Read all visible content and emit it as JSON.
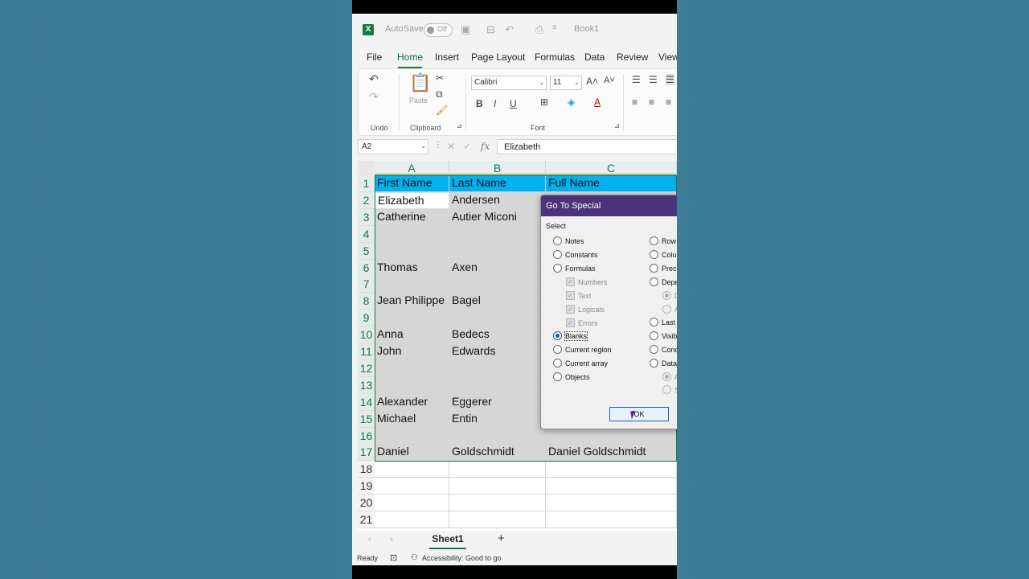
{
  "titlebar": {
    "logo": "X",
    "autosave_label": "AutoSave",
    "toggle_label": "Off",
    "book_title": "Book1"
  },
  "tabs": [
    "File",
    "Home",
    "Insert",
    "Page Layout",
    "Formulas",
    "Data",
    "Review",
    "View"
  ],
  "ribbon": {
    "undo_label": "Undo",
    "paste_label": "Paste",
    "clipboard_label": "Clipboard",
    "font_name": "Calibri",
    "font_size": "11",
    "font_label": "Font",
    "bold": "B",
    "italic": "I",
    "underline": "U"
  },
  "formula_bar": {
    "name_box": "A2",
    "fx": "fx",
    "value": "Elizabeth"
  },
  "grid": {
    "columns": [
      "A",
      "B",
      "C"
    ],
    "rows": [
      {
        "n": "1",
        "a": "First Name",
        "b": "Last Name",
        "c": "Full Name"
      },
      {
        "n": "2",
        "a": "Elizabeth",
        "b": "Andersen",
        "c": ""
      },
      {
        "n": "3",
        "a": "Catherine",
        "b": "Autier Miconi",
        "c": ""
      },
      {
        "n": "4",
        "a": "",
        "b": "",
        "c": ""
      },
      {
        "n": "5",
        "a": "",
        "b": "",
        "c": ""
      },
      {
        "n": "6",
        "a": "Thomas",
        "b": "Axen",
        "c": ""
      },
      {
        "n": "7",
        "a": "",
        "b": "",
        "c": ""
      },
      {
        "n": "8",
        "a": "Jean Philippe",
        "b": "Bagel",
        "c": ""
      },
      {
        "n": "9",
        "a": "",
        "b": "",
        "c": ""
      },
      {
        "n": "10",
        "a": "Anna",
        "b": "Bedecs",
        "c": ""
      },
      {
        "n": "11",
        "a": "John",
        "b": "Edwards",
        "c": ""
      },
      {
        "n": "12",
        "a": "",
        "b": "",
        "c": ""
      },
      {
        "n": "13",
        "a": "",
        "b": "",
        "c": ""
      },
      {
        "n": "14",
        "a": "Alexander",
        "b": "Eggerer",
        "c": ""
      },
      {
        "n": "15",
        "a": "Michael",
        "b": "Entin",
        "c": ""
      },
      {
        "n": "16",
        "a": "",
        "b": "",
        "c": ""
      },
      {
        "n": "17",
        "a": "Daniel",
        "b": "Goldschmidt",
        "c": "Daniel Goldschmidt"
      },
      {
        "n": "18",
        "a": "",
        "b": "",
        "c": ""
      },
      {
        "n": "19",
        "a": "",
        "b": "",
        "c": ""
      },
      {
        "n": "20",
        "a": "",
        "b": "",
        "c": ""
      },
      {
        "n": "21",
        "a": "",
        "b": "",
        "c": ""
      }
    ]
  },
  "sheets": {
    "active": "Sheet1",
    "add": "+"
  },
  "status": {
    "ready": "Ready",
    "accessibility": "Accessibility: Good to go"
  },
  "dialog": {
    "title": "Go To Special",
    "section": "Select",
    "left_options": [
      "Notes",
      "Constants",
      "Formulas",
      "Numbers",
      "Text",
      "Logicals",
      "Errors",
      "Blanks",
      "Current region",
      "Current array",
      "Objects"
    ],
    "right_options": [
      "Row",
      "Colu",
      "Prece",
      "Depe",
      "D",
      "A",
      "Last",
      "Visib",
      "Cond",
      "Data",
      "A",
      "S"
    ],
    "ok": "OK"
  },
  "colors": {
    "accent": "#107c41",
    "header_fill": "#00b0f0",
    "dialog_title": "#4b3379",
    "selection": "#d6d6d6"
  }
}
